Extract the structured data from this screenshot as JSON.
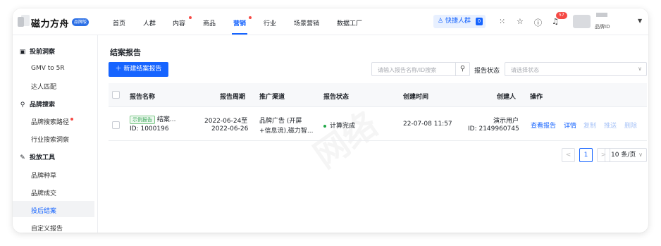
{
  "app": {
    "name": "磁力方舟",
    "badge": "品牌版"
  },
  "nav": {
    "items": [
      {
        "label": "首页",
        "dot": false
      },
      {
        "label": "人群",
        "dot": false
      },
      {
        "label": "内容",
        "dot": true
      },
      {
        "label": "商品",
        "dot": false
      },
      {
        "label": "营销",
        "dot": true,
        "active": true
      },
      {
        "label": "行业",
        "dot": false
      },
      {
        "label": "场景营销",
        "dot": false
      },
      {
        "label": "数据工厂",
        "dot": false
      }
    ],
    "quick_crowd": "快捷人群",
    "quick_crowd_count": "0",
    "notification_count": "57",
    "account_id_label": "品牌ID"
  },
  "icons": [
    "apps-grid-icon",
    "star-icon",
    "help-icon",
    "bell-icon",
    "user-icon",
    "search-icon",
    "chevron-down-icon",
    "plus-icon"
  ],
  "sidebar": {
    "groups": [
      {
        "title": "投前洞察",
        "icon": "monitor-icon",
        "items": [
          "GMV to 5R",
          "达人匹配"
        ]
      },
      {
        "title": "品牌搜索",
        "icon": "search-icon",
        "items": [
          "品牌搜索路径",
          "行业搜索洞察"
        ]
      },
      {
        "title": "投放工具",
        "icon": "wrench-icon",
        "items": [
          "品牌种草",
          "品牌成交",
          "投后结案",
          "自定义报告"
        ]
      }
    ],
    "active_item": "投后结案"
  },
  "page": {
    "title": "结案报告",
    "new_button": "新建结案报告",
    "search_placeholder": "请输入报告名称/ID搜索",
    "status_label": "报告状态",
    "status_placeholder": "请选择状态"
  },
  "table": {
    "columns": [
      "报告名称",
      "报告周期",
      "推广渠道",
      "报告状态",
      "创建时间",
      "创建人",
      "操作"
    ],
    "rows": [
      {
        "tag": "示例报告",
        "name": "结案...",
        "id": "ID: 1000196",
        "period_start": "2022-06-24至",
        "period_end": "2022-06-26",
        "channel_line1": "品牌广告 (开屏",
        "channel_line2": "+信息流),磁力智...",
        "status": "计算完成",
        "created_at": "22-07-08 11:57",
        "creator": "演示用户",
        "creator_id": "ID: 2149960745",
        "actions": [
          "查看报告",
          "详情",
          "复制",
          "推送",
          "删除"
        ]
      }
    ]
  },
  "pagination": {
    "prev": "<",
    "current": "1",
    "next": ">",
    "page_size": "10 条/页"
  },
  "colors": {
    "primary": "#1664ff",
    "success": "#21a848",
    "danger": "#f54a45"
  }
}
